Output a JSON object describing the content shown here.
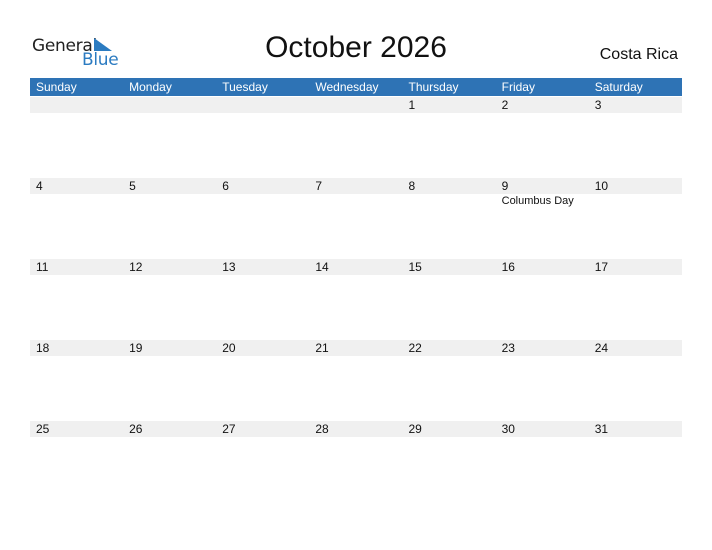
{
  "brand": {
    "general": "General",
    "blue": "Blue"
  },
  "title": "October 2026",
  "country": "Costa Rica",
  "colors": {
    "accent": "#2e73b5",
    "day_bar": "#f0f0f0"
  },
  "weekdays": [
    "Sunday",
    "Monday",
    "Tuesday",
    "Wednesday",
    "Thursday",
    "Friday",
    "Saturday"
  ],
  "weeks": [
    {
      "days": [
        "",
        "",
        "",
        "",
        "1",
        "2",
        "3"
      ],
      "events": [
        "",
        "",
        "",
        "",
        "",
        "",
        ""
      ]
    },
    {
      "days": [
        "4",
        "5",
        "6",
        "7",
        "8",
        "9",
        "10"
      ],
      "events": [
        "",
        "",
        "",
        "",
        "",
        "Columbus Day",
        ""
      ]
    },
    {
      "days": [
        "11",
        "12",
        "13",
        "14",
        "15",
        "16",
        "17"
      ],
      "events": [
        "",
        "",
        "",
        "",
        "",
        "",
        ""
      ]
    },
    {
      "days": [
        "18",
        "19",
        "20",
        "21",
        "22",
        "23",
        "24"
      ],
      "events": [
        "",
        "",
        "",
        "",
        "",
        "",
        ""
      ]
    },
    {
      "days": [
        "25",
        "26",
        "27",
        "28",
        "29",
        "30",
        "31"
      ],
      "events": [
        "",
        "",
        "",
        "",
        "",
        "",
        ""
      ]
    }
  ]
}
